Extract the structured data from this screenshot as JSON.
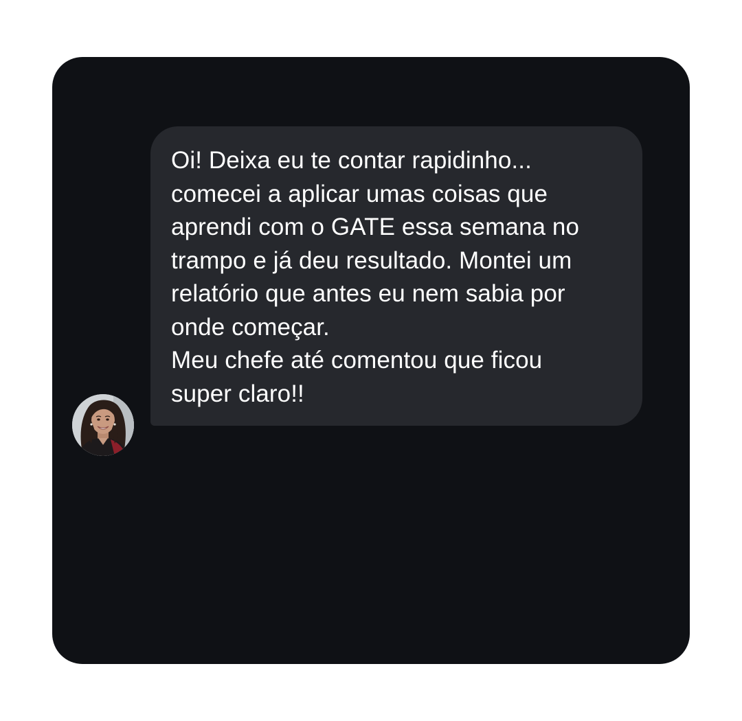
{
  "conversation": {
    "message": {
      "lines": [
        "Oi! Deixa eu te contar rapidinho...",
        "comecei a aplicar umas coisas que",
        "aprendi com o GATE essa semana no",
        "trampo e já deu resultado. Montei um",
        "relatório que antes eu nem sabia por",
        "onde começar.",
        "Meu chefe até comentou que ficou",
        "super claro!!"
      ]
    },
    "avatar": {
      "icon": "user-photo-avatar"
    }
  },
  "colors": {
    "page_background": "#ffffff",
    "card_background": "#0f1115",
    "bubble_background": "#26282d",
    "text": "#ffffff"
  }
}
